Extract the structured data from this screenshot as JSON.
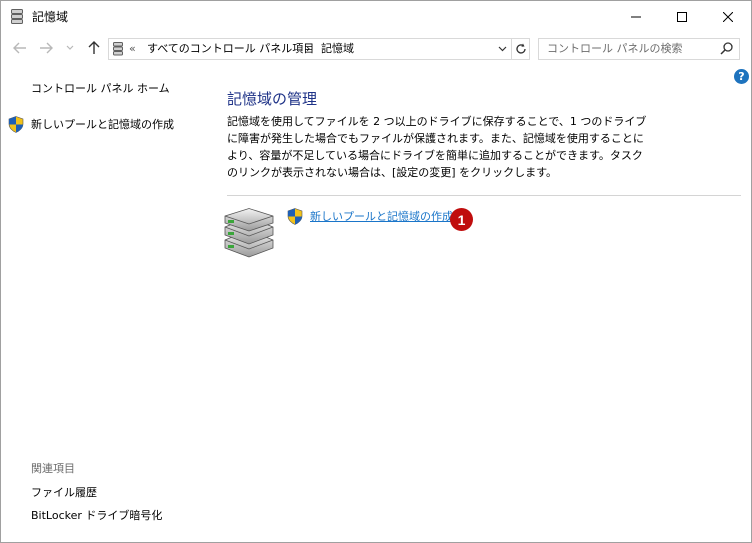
{
  "window": {
    "title": "記憶域",
    "icon": "storage-spaces-icon",
    "buttons": {
      "minimize": "minimize-icon",
      "maximize": "maximize-icon",
      "close": "close-icon"
    }
  },
  "address": {
    "overflow": "«",
    "path": [
      "すべてのコントロール パネル項目",
      "記憶域"
    ],
    "separator": "›"
  },
  "search": {
    "placeholder": "コントロール パネルの検索"
  },
  "sidebar": {
    "home": "コントロール パネル ホーム",
    "create_pool": "新しいプールと記憶域の作成",
    "see_also_title": "関連項目",
    "see_also": [
      "ファイル履歴",
      "BitLocker ドライブ暗号化"
    ]
  },
  "main": {
    "heading": "記憶域の管理",
    "description": "記憶域を使用してファイルを 2 つ以上のドライブに保存することで、1 つのドライブに障害が発生した場合でもファイルが保護されます。また、記憶域を使用することにより、容量が不足している場合にドライブを簡単に追加することができます。タスクのリンクが表示されない場合は、[設定の変更] をクリックします。",
    "create_link": "新しいプールと記憶域の作成",
    "badge": "1",
    "help": "?"
  },
  "colors": {
    "heading": "#1e3287",
    "link": "#1a75c9",
    "badge": "#c00d0d",
    "help": "#1e73be"
  }
}
